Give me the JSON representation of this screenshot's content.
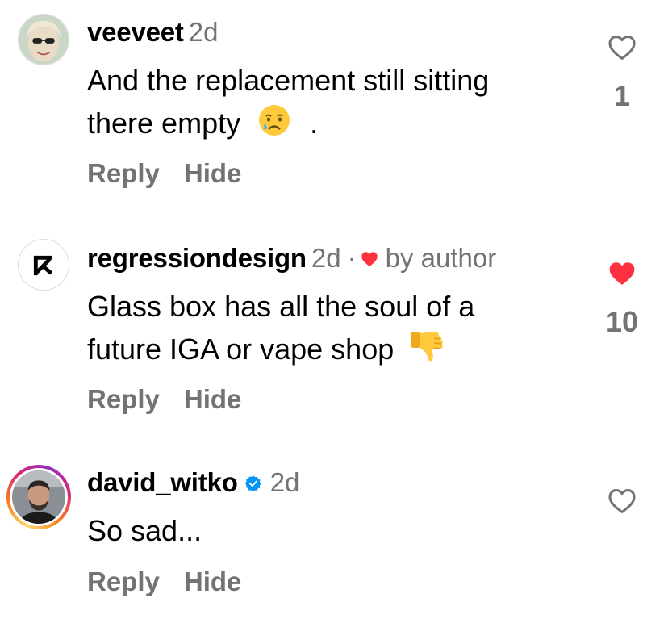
{
  "comments": [
    {
      "username": "veeveet",
      "time": "2d",
      "text_line1": "And the replacement still sitting",
      "text_line2": "there empty",
      "text_tail": ".",
      "emoji": "crying-face",
      "reply_label": "Reply",
      "hide_label": "Hide",
      "like_count": "1",
      "liked": false
    },
    {
      "username": "regressiondesign",
      "time": "2d",
      "separator": "·",
      "by_author_label": "by author",
      "text_line1": "Glass box has all the soul of a",
      "text_line2": "future IGA or vape shop",
      "emoji": "thumbs-down",
      "reply_label": "Reply",
      "hide_label": "Hide",
      "like_count": "10",
      "liked": true
    },
    {
      "username": "david_witko",
      "time": "2d",
      "verified": true,
      "text_line1": "So sad...",
      "reply_label": "Reply",
      "hide_label": "Hide",
      "liked": false
    }
  ],
  "colors": {
    "like_active": "#ff3040",
    "secondary_text": "#737373",
    "verified": "#0095f6"
  }
}
